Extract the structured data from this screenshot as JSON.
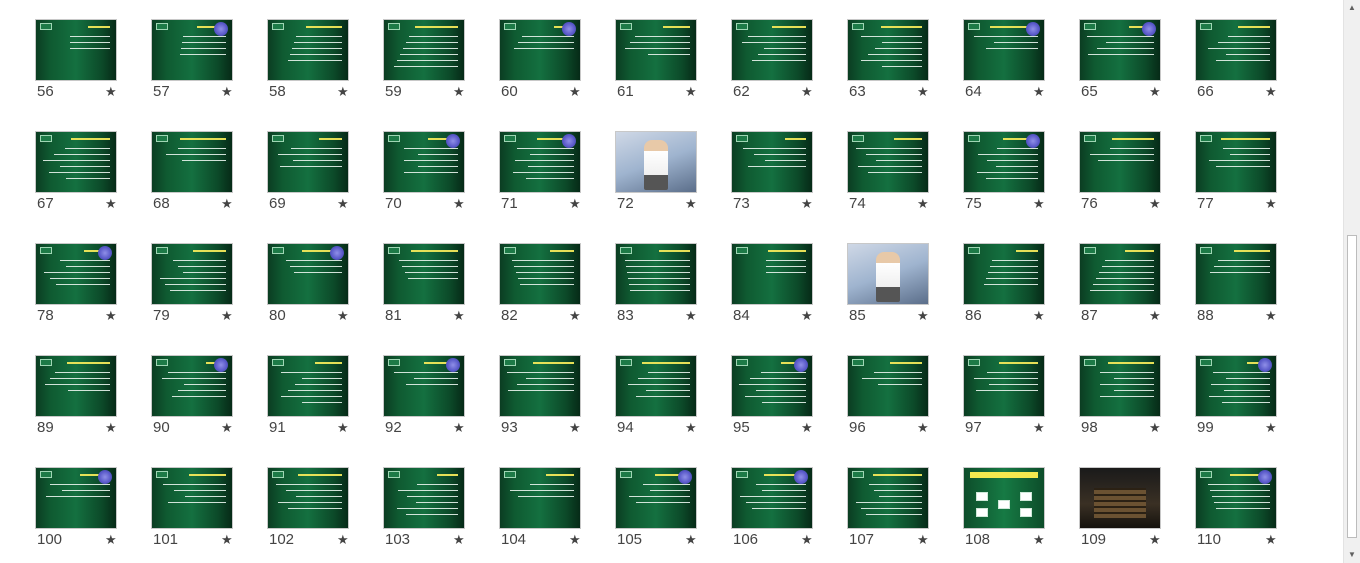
{
  "sorter": {
    "rows": [
      {
        "slides": [
          {
            "number": "56",
            "kind": "green"
          },
          {
            "number": "57",
            "kind": "green"
          },
          {
            "number": "58",
            "kind": "green"
          },
          {
            "number": "59",
            "kind": "green"
          },
          {
            "number": "60",
            "kind": "green"
          },
          {
            "number": "61",
            "kind": "green"
          },
          {
            "number": "62",
            "kind": "green"
          },
          {
            "number": "63",
            "kind": "green"
          },
          {
            "number": "64",
            "kind": "green"
          },
          {
            "number": "65",
            "kind": "green"
          },
          {
            "number": "66",
            "kind": "green"
          }
        ]
      },
      {
        "slides": [
          {
            "number": "67",
            "kind": "green"
          },
          {
            "number": "68",
            "kind": "green"
          },
          {
            "number": "69",
            "kind": "green"
          },
          {
            "number": "70",
            "kind": "green"
          },
          {
            "number": "71",
            "kind": "green"
          },
          {
            "number": "72",
            "kind": "photo"
          },
          {
            "number": "73",
            "kind": "green"
          },
          {
            "number": "74",
            "kind": "green"
          },
          {
            "number": "75",
            "kind": "green"
          },
          {
            "number": "76",
            "kind": "green"
          },
          {
            "number": "77",
            "kind": "green"
          }
        ]
      },
      {
        "slides": [
          {
            "number": "78",
            "kind": "green"
          },
          {
            "number": "79",
            "kind": "green"
          },
          {
            "number": "80",
            "kind": "green"
          },
          {
            "number": "81",
            "kind": "green"
          },
          {
            "number": "82",
            "kind": "green"
          },
          {
            "number": "83",
            "kind": "green"
          },
          {
            "number": "84",
            "kind": "green"
          },
          {
            "number": "85",
            "kind": "photo"
          },
          {
            "number": "86",
            "kind": "green"
          },
          {
            "number": "87",
            "kind": "green"
          },
          {
            "number": "88",
            "kind": "green"
          }
        ]
      },
      {
        "slides": [
          {
            "number": "89",
            "kind": "green"
          },
          {
            "number": "90",
            "kind": "green"
          },
          {
            "number": "91",
            "kind": "green"
          },
          {
            "number": "92",
            "kind": "green"
          },
          {
            "number": "93",
            "kind": "green"
          },
          {
            "number": "94",
            "kind": "green"
          },
          {
            "number": "95",
            "kind": "green"
          },
          {
            "number": "96",
            "kind": "green"
          },
          {
            "number": "97",
            "kind": "green"
          },
          {
            "number": "98",
            "kind": "green"
          },
          {
            "number": "99",
            "kind": "green"
          }
        ]
      },
      {
        "slides": [
          {
            "number": "100",
            "kind": "green"
          },
          {
            "number": "101",
            "kind": "green"
          },
          {
            "number": "102",
            "kind": "green"
          },
          {
            "number": "103",
            "kind": "green"
          },
          {
            "number": "104",
            "kind": "green"
          },
          {
            "number": "105",
            "kind": "green"
          },
          {
            "number": "106",
            "kind": "green"
          },
          {
            "number": "107",
            "kind": "green"
          },
          {
            "number": "108",
            "kind": "flow"
          },
          {
            "number": "109",
            "kind": "dark"
          },
          {
            "number": "110",
            "kind": "green"
          }
        ]
      }
    ],
    "star_glyph": "★",
    "transition_icon": "star-icon"
  },
  "scrollbar": {
    "up_glyph": "▲",
    "down_glyph": "▼",
    "position_fraction": 0.55
  },
  "colors": {
    "slide_green": "#147040",
    "slide_title_yellow": "#f2e85a",
    "number_text": "#444444"
  }
}
